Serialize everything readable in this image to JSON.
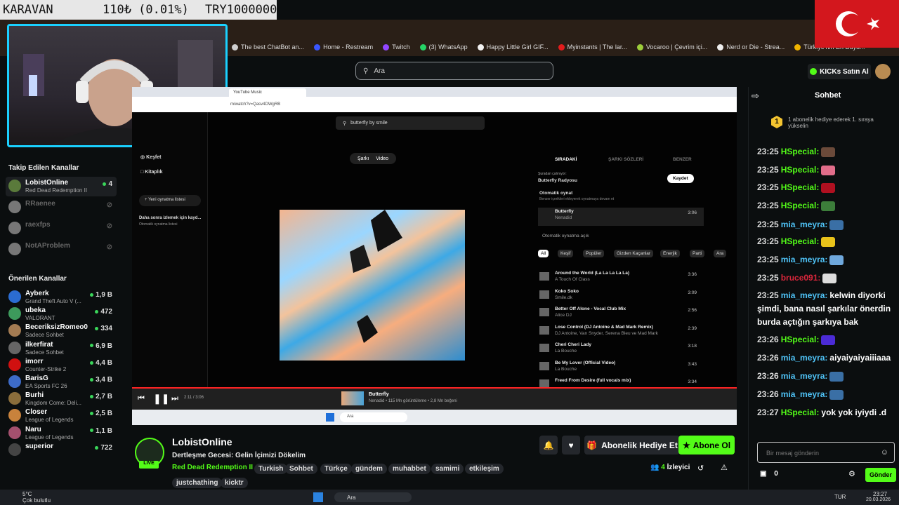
{
  "ticker": {
    "name": "KARAVAN",
    "price": "110₺ (0.01%)",
    "pair": "TRY1000000"
  },
  "bookmarks": [
    {
      "label": "The best ChatBot an...",
      "color": "#cfcfcf"
    },
    {
      "label": "Home - Restream",
      "color": "#3a57ff"
    },
    {
      "label": "Twitch",
      "color": "#9146ff"
    },
    {
      "label": "(3) WhatsApp",
      "color": "#25d366"
    },
    {
      "label": "Happy Little Girl GIF...",
      "color": "#f2f2f2"
    },
    {
      "label": "Myinstants | The lar...",
      "color": "#e21c1c"
    },
    {
      "label": "Vocaroo | Çevrim içi...",
      "color": "#9ccd3a"
    },
    {
      "label": "Nerd or Die - Strea...",
      "color": "#eeeeee"
    },
    {
      "label": "Türkiye'nin En Büyü...",
      "color": "#f0b400"
    }
  ],
  "header": {
    "search_placeholder": "Ara",
    "kicks_label": "KICKs Satın Al"
  },
  "sidebar": {
    "followed_title": "Takip Edilen Kanallar",
    "followed": [
      {
        "name": "LobistOnline",
        "game": "Red Dead Redemption II",
        "viewers": "4",
        "online": true,
        "color": "#5a7a3b"
      },
      {
        "name": "RRaenee",
        "game": "",
        "viewers": "",
        "online": false,
        "color": "#777"
      },
      {
        "name": "raexfps",
        "game": "",
        "viewers": "",
        "online": false,
        "color": "#777"
      },
      {
        "name": "NotAProblem",
        "game": "",
        "viewers": "",
        "online": false,
        "color": "#777"
      }
    ],
    "suggested_title": "Önerilen Kanallar",
    "suggested": [
      {
        "name": "Ayberk",
        "game": "Grand Theft Auto V (...",
        "viewers": "1,9 B",
        "color": "#2b6cd1"
      },
      {
        "name": "ubeka",
        "game": "VALORANT",
        "viewers": "472",
        "color": "#3d9a5c"
      },
      {
        "name": "BeceriksizRomeo0",
        "game": "Sadece Sohbet",
        "viewers": "334",
        "color": "#a37b52"
      },
      {
        "name": "ilkerfirat",
        "game": "Sadece Sohbet",
        "viewers": "6,9 B",
        "color": "#666"
      },
      {
        "name": "imorr",
        "game": "Counter-Strike 2",
        "viewers": "4,4 B",
        "color": "#d01010"
      },
      {
        "name": "BarisG",
        "game": "EA Sports FC 26",
        "viewers": "3,4 B",
        "color": "#3d6bc7"
      },
      {
        "name": "Burhi",
        "game": "Kingdom Come: Deli...",
        "viewers": "2,7 B",
        "color": "#8a6d3b"
      },
      {
        "name": "Closer",
        "game": "League of Legends",
        "viewers": "2,5 B",
        "color": "#c8823c"
      },
      {
        "name": "Naru",
        "game": "League of Legends",
        "viewers": "1,1 B",
        "color": "#a4506e"
      },
      {
        "name": "superior",
        "game": "",
        "viewers": "722",
        "color": "#444"
      }
    ]
  },
  "video": {
    "tab_title": "YouTube Music",
    "url": "m/watch?v=Qasv4DWgRB",
    "yt_search": "butterfly by smile",
    "nav": {
      "explore": "Keşfet",
      "library": "Kitaplık",
      "new_playlist": "Yeni oynatma listesi",
      "later": "Daha sonra izlemek için kayd...",
      "later_sub": "Otomatik oynatma listesi"
    },
    "toggle": {
      "song": "Şarkı",
      "video": "Video"
    },
    "queue_tabs": [
      "SIRADAKİ",
      "ŞARKI SÖZLERİ",
      "BENZER"
    ],
    "playing_from": "Şuradan çalınıyor:",
    "radio": "Butterfly Radyosu",
    "save": "Kaydet",
    "autoplay": "Otomatik oynat",
    "autoplay_sub": "Benzer içerikleri ekleyerek oynatmaya devam et",
    "current": {
      "title": "Butterfly",
      "artist": "Nenadid",
      "duration": "3:06"
    },
    "autoplay_on": "Otomatik oynatma açık",
    "chips": [
      "All",
      "Keşif",
      "Popüler",
      "Gizden Kaçanlar",
      "Enerjik",
      "Parti",
      "Ara"
    ],
    "queue": [
      {
        "title": "Around the World (La La La La La)",
        "artist": "A Touch Of Class",
        "duration": "3:36"
      },
      {
        "title": "Koko Soko",
        "artist": "Smile.dk",
        "duration": "3:09"
      },
      {
        "title": "Better Off Alone - Vocal Club Mix",
        "artist": "Alice DJ",
        "duration": "2:56"
      },
      {
        "title": "Lose Control (DJ Antoine & Mad Mark Remix)",
        "artist": "DJ Antoine, Van Snyder, Serena Bleu ve Mad Mark",
        "duration": "2:39"
      },
      {
        "title": "Cheri Cheri Lady",
        "artist": "La Bouche",
        "duration": "3:18"
      },
      {
        "title": "Be My Lover (Official Video)",
        "artist": "La Bouche",
        "duration": "3:43"
      },
      {
        "title": "Freed From Desire (full vocals mix)",
        "artist": "",
        "duration": "3:34"
      }
    ],
    "player": {
      "time": "2:11 / 3:06",
      "title": "Butterfly",
      "meta": "Nenadid • 115 Mn görüntüleme • 2,8 Mn beğeni"
    },
    "taskbar_search": "Ara"
  },
  "stream": {
    "live": "LIVE",
    "channel": "LobistOnline",
    "title": "Dertleşme Gecesi: Gelin İçimizi Dökelim",
    "game": "Red Dead Redemption II",
    "tags": [
      "Turkish",
      "Sohbet",
      "Türkçe",
      "gündem",
      "muhabbet",
      "samimi",
      "etkileşim"
    ],
    "tags2": [
      "justchathing",
      "kicktr"
    ],
    "gift_label": "Abonelik Hediye Et",
    "subscribe_label": "Abone Ol",
    "viewers": "4",
    "viewers_label": "İzleyici"
  },
  "chat": {
    "title": "Sohbet",
    "banner": "1 abonelik hediye ederek 1. sıraya yükselin",
    "rank": "1",
    "messages": [
      {
        "time": "23:25",
        "user": "HSpecial:",
        "color": "#53fc18",
        "text": "",
        "emote": "#6b4a3a"
      },
      {
        "time": "23:25",
        "user": "HSpecial:",
        "color": "#53fc18",
        "text": "",
        "emote": "#e26d8a"
      },
      {
        "time": "23:25",
        "user": "HSpecial:",
        "color": "#53fc18",
        "text": "",
        "emote": "#b01020"
      },
      {
        "time": "23:25",
        "user": "HSpecial:",
        "color": "#53fc18",
        "text": "",
        "emote": "#3c7d3a"
      },
      {
        "time": "23:25",
        "user": "mia_meyra:",
        "color": "#4fc3f7",
        "text": "",
        "emote": "#3a6fa5"
      },
      {
        "time": "23:25",
        "user": "HSpecial:",
        "color": "#53fc18",
        "text": "",
        "emote": "#e8c21a"
      },
      {
        "time": "23:25",
        "user": "mia_meyra:",
        "color": "#4fc3f7",
        "text": "",
        "emote": "#6fa8dc"
      },
      {
        "time": "23:25",
        "user": "bruce091:",
        "color": "#d8263b",
        "text": "",
        "emote": "#dddddd"
      },
      {
        "time": "23:25",
        "user": "mia_meyra:",
        "color": "#4fc3f7",
        "text": "kelwin diyorki şimdi, bana nasıl şarkılar önerdin burda açtığın şarkıya bak",
        "emote": ""
      },
      {
        "time": "23:26",
        "user": "HSpecial:",
        "color": "#53fc18",
        "text": "",
        "emote": "#4b2bd6"
      },
      {
        "time": "23:26",
        "user": "mia_meyra:",
        "color": "#4fc3f7",
        "text": "aiyaiyaiyaiiiaaa",
        "emote": ""
      },
      {
        "time": "23:26",
        "user": "mia_meyra:",
        "color": "#4fc3f7",
        "text": "",
        "emote": "#3a6fa5"
      },
      {
        "time": "23:26",
        "user": "mia_meyra:",
        "color": "#4fc3f7",
        "text": "",
        "emote": "#3a6fa5"
      },
      {
        "time": "23:27",
        "user": "HSpecial:",
        "color": "#53fc18",
        "text": "yok yok iyiydi .d",
        "emote": ""
      }
    ],
    "input_placeholder": "Bir mesaj gönderin",
    "points": "0",
    "send_label": "Gönder"
  },
  "os": {
    "weather_temp": "5°C",
    "weather_text": "Çok bulutlu",
    "search": "Ara",
    "lang": "TUR",
    "time": "23:27",
    "date": "20.03.2026"
  }
}
